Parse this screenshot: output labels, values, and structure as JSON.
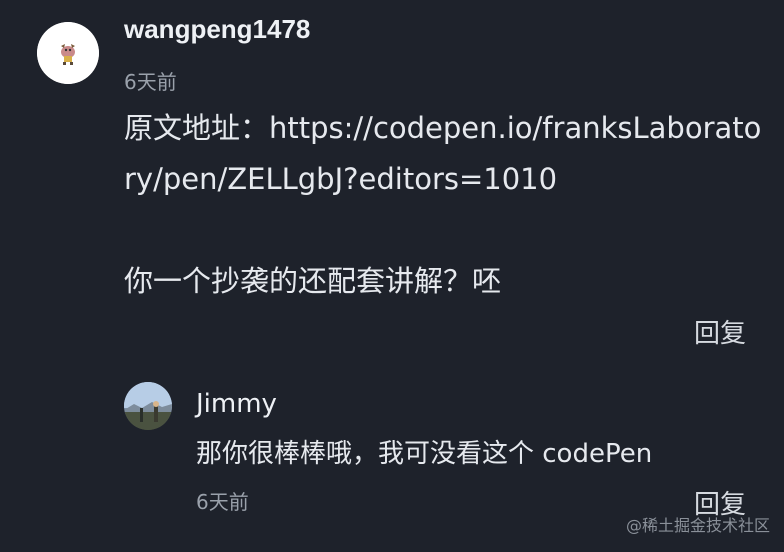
{
  "comment": {
    "username": "wangpeng1478",
    "time": "6天前",
    "content_line1": "原文地址：https://codepen.io/franksLaboratory/pen/ZELLgbJ?editors=1010",
    "content_line2": "你一个抄袭的还配套讲解？呸",
    "reply_label": "回复"
  },
  "sub_reply": {
    "username": "Jimmy",
    "content": "那你很棒棒哦，我可没看这个 codePen",
    "time": "6天前",
    "reply_label": "回复"
  },
  "watermark": "@稀土掘金技术社区",
  "colors": {
    "background": "#1e222b",
    "text": "#e6e9ee",
    "muted": "#9aa1ab"
  },
  "icons": {
    "main_avatar": "cartoon-avatar-icon",
    "reply_avatar": "landscape-avatar"
  }
}
